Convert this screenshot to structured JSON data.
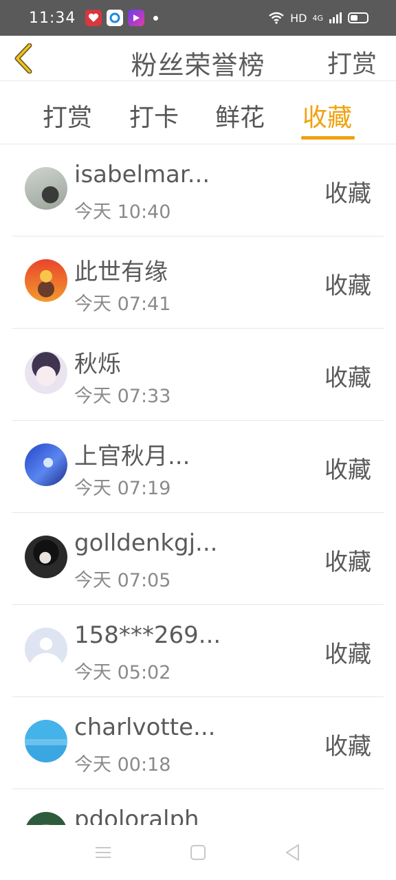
{
  "status_bar": {
    "time": "11:34",
    "network": "HD",
    "signal": "4G"
  },
  "header": {
    "title": "粉丝荣誉榜",
    "action_label": "打赏"
  },
  "tabs": [
    {
      "label": "打赏",
      "active": false
    },
    {
      "label": "打卡",
      "active": false
    },
    {
      "label": "鲜花",
      "active": false
    },
    {
      "label": "收藏",
      "active": true
    }
  ],
  "colors": {
    "accent": "#f0a20e",
    "status_bar": "#5a5a5a",
    "text": "#5a5a5a"
  },
  "list": [
    {
      "name": "isabelmar...",
      "time": "今天 10:40",
      "action": "收藏"
    },
    {
      "name": "此世有缘",
      "time": "今天 07:41",
      "action": "收藏"
    },
    {
      "name": "秋烁",
      "time": "今天 07:33",
      "action": "收藏"
    },
    {
      "name": "上官秋月...",
      "time": "今天 07:19",
      "action": "收藏"
    },
    {
      "name": "golldenkgj...",
      "time": "今天 07:05",
      "action": "收藏"
    },
    {
      "name": "158***269...",
      "time": "今天 05:02",
      "action": "收藏"
    },
    {
      "name": "charlvotte...",
      "time": "今天 00:18",
      "action": "收藏"
    },
    {
      "name": "pdoloralph",
      "time": "",
      "action": ""
    }
  ]
}
